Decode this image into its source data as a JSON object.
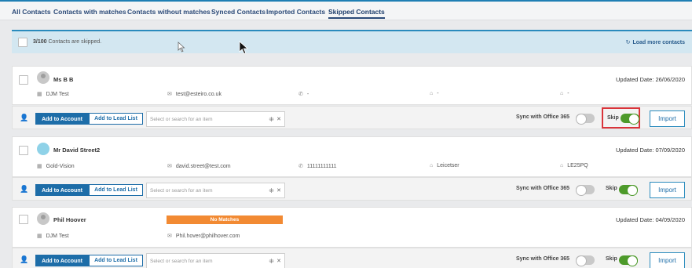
{
  "tabs": [
    {
      "label": "All Contacts"
    },
    {
      "label": "Contacts with matches"
    },
    {
      "label": "Contacts without matches"
    },
    {
      "label": "Synced Contacts"
    },
    {
      "label": "Imported Contacts"
    },
    {
      "label": "Skipped Contacts",
      "active": true
    }
  ],
  "info_bar": {
    "count": "3/100",
    "message": " Contacts are skipped.",
    "load_more_label": "Load more contacts",
    "load_more_icon": "load-more-icon"
  },
  "actions": {
    "add_to_account_label": "Add to Account",
    "add_to_lead_list_label": "Add to Lead List",
    "select_placeholder": "Select or search for an item",
    "sync_label": "Sync with Office 365",
    "skip_label": "Skip",
    "import_label": "Import"
  },
  "contacts": [
    {
      "name": "Ms B B",
      "updated": "Updated Date: 26/06/2020",
      "company": "DJM Test",
      "email": "test@esteiro.co.uk",
      "phone": "-",
      "city": "-",
      "postcode": "-",
      "no_match_label": "",
      "sync_on": false,
      "skip_on": true
    },
    {
      "name": "Mr David Street2",
      "updated": "Updated Date: 07/09/2020",
      "company": "Gold-Vision",
      "email": "david.street@test.com",
      "phone": "11111111111",
      "city": "Leicetser",
      "postcode": "LE25PQ",
      "no_match_label": "",
      "sync_on": false,
      "skip_on": true
    },
    {
      "name": "Phil Hoover",
      "updated": "Updated Date: 04/09/2020",
      "company": "DJM Test",
      "email": "Phil.hover@philhover.com",
      "phone": "",
      "city": "",
      "postcode": "",
      "no_match_label": "No Matches",
      "sync_on": false,
      "skip_on": true
    }
  ],
  "colors": {
    "accent": "#1d6da8",
    "toggle_on": "#4d9a2a",
    "no_match": "#f28a33",
    "highlight": "#d9343a"
  }
}
